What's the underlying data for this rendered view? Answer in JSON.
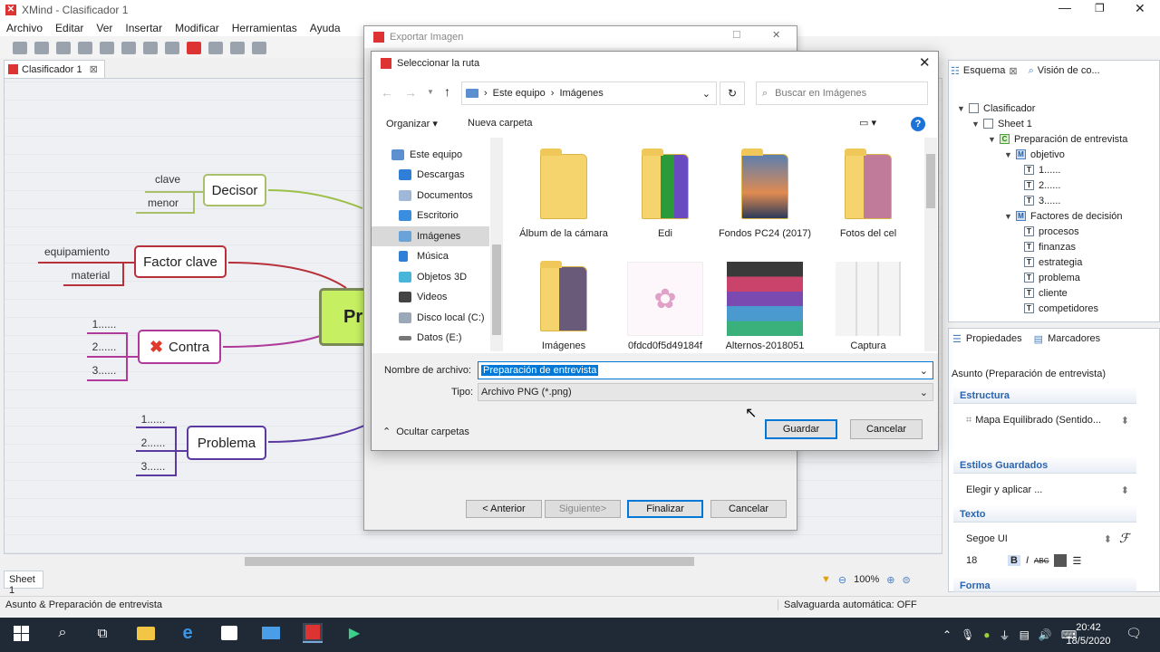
{
  "app": {
    "title": "XMind - Clasificador 1",
    "menus": [
      "Archivo",
      "Editar",
      "Ver",
      "Insertar",
      "Modificar",
      "Herramientas",
      "Ayuda"
    ],
    "editor_tab": "Clasificador 1",
    "sheet_tab": "Sheet 1",
    "zoom": "100%",
    "status_left": "Asunto & Preparación de entrevista",
    "status_right": "Salvaguarda automática: OFF"
  },
  "map": {
    "central": "Pr",
    "decisor": {
      "label": "Decisor",
      "subs": [
        "clave",
        "menor"
      ]
    },
    "factor": {
      "label": "Factor clave",
      "subs": [
        "equipamiento",
        "material"
      ]
    },
    "contra": {
      "label": "Contra",
      "subs": [
        "1......",
        "2......",
        "3......"
      ]
    },
    "problema": {
      "label": "Problema",
      "subs": [
        "1......",
        "2......",
        "3......"
      ]
    }
  },
  "outline": {
    "tab": "Esquema",
    "tab2": "Visión de co...",
    "items": [
      "Clasificador",
      "Sheet 1",
      "Preparación de entrevista",
      "objetivo",
      "1......",
      "2......",
      "3......",
      "Factores de decisión",
      "procesos",
      "finanzas",
      "estrategia",
      "problema",
      "cliente",
      "competidores"
    ]
  },
  "props": {
    "tab": "Propiedades",
    "tab2": "Marcadores",
    "subject": "Asunto (Preparación de entrevista)",
    "estructura_h": "Estructura",
    "estructura_v": "Mapa Equilibrado (Sentido...",
    "estilos_h": "Estilos Guardados",
    "estilos_v": "Elegir y aplicar ...",
    "texto_h": "Texto",
    "font": "Segoe UI",
    "size": "18",
    "forma_h": "Forma"
  },
  "export_dialog": {
    "title": "Exportar Imagen",
    "back": "< Anterior",
    "next": "Siguiente>",
    "finish": "Finalizar",
    "cancel": "Cancelar"
  },
  "save_dialog": {
    "title": "Seleccionar la ruta",
    "path": [
      "Este equipo",
      "Imágenes"
    ],
    "search_placeholder": "Buscar en Imágenes",
    "organize": "Organizar",
    "new_folder": "Nueva carpeta",
    "nav": [
      "Este equipo",
      "Descargas",
      "Documentos",
      "Escritorio",
      "Imágenes",
      "Música",
      "Objetos 3D",
      "Videos",
      "Disco local (C:)",
      "Datos (E:)"
    ],
    "files": [
      "Álbum de la cámara",
      "Edi",
      "Fondos PC24 (2017)",
      "Fotos del cel",
      "Imágenes",
      "0fdcd0f5d49184f",
      "Alternos-2018051",
      "Captura"
    ],
    "filename_label": "Nombre de archivo:",
    "filename": "Preparación de entrevista",
    "type_label": "Tipo:",
    "type": "Archivo PNG (*.png)",
    "hide_folders": "Ocultar carpetas",
    "save": "Guardar",
    "cancel": "Cancelar"
  },
  "taskbar": {
    "time": "20:42",
    "date": "18/5/2020"
  }
}
